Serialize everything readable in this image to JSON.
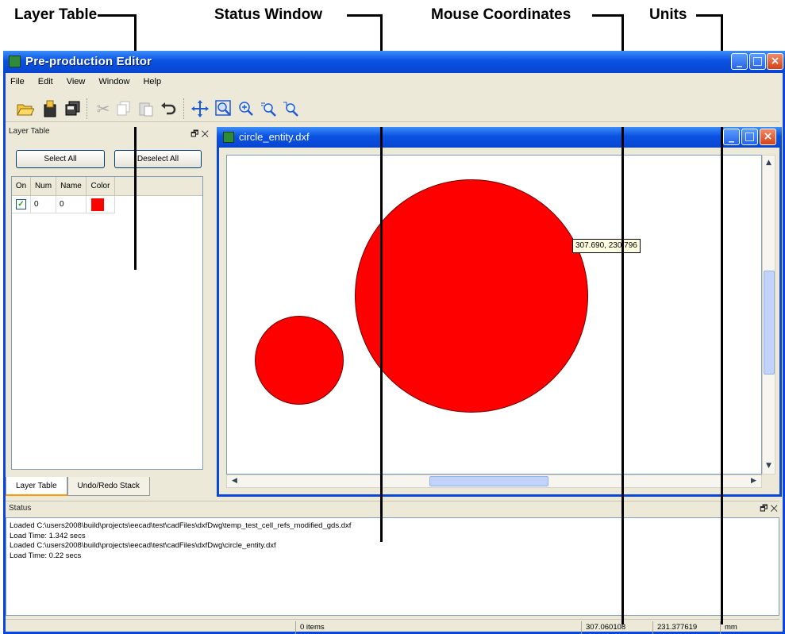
{
  "callouts": {
    "layer_table": "Layer Table",
    "status_window": "Status Window",
    "mouse_coordinates": "Mouse Coordinates",
    "units": "Units"
  },
  "app": {
    "title": "Pre-production Editor",
    "menu": [
      "File",
      "Edit",
      "View",
      "Window",
      "Help"
    ],
    "toolbar_icons": [
      "open-icon",
      "save-icon",
      "save-all-icon",
      "cut-icon",
      "copy-icon",
      "paste-icon",
      "undo-icon",
      "pan-icon",
      "zoom-window-icon",
      "zoom-in-icon",
      "zoom-out-icon",
      "zoom-fit-icon"
    ]
  },
  "layer_dock": {
    "title": "Layer Table",
    "select_all": "Select All",
    "deselect_all": "Deselect All",
    "columns": [
      "On",
      "Num",
      "Name",
      "Color"
    ],
    "rows": [
      {
        "on": true,
        "num": "0",
        "name": "0",
        "color": "#ff0000"
      }
    ],
    "tabs": [
      "Layer Table",
      "Undo/Redo Stack"
    ]
  },
  "document": {
    "title": "circle_entity.dxf",
    "tooltip": "307.690, 230.796",
    "shape_color": "#ff0000"
  },
  "status_dock": {
    "title": "Status",
    "log": [
      "Loaded C:\\users2008\\build\\projects\\eecad\\test\\cadFiles\\dxfDwg\\temp_test_cell_refs_modified_gds.dxf",
      "Load Time: 1.342 secs",
      "Loaded C:\\users2008\\build\\projects\\eecad\\test\\cadFiles\\dxfDwg\\circle_entity.dxf",
      "Load Time: 0.22 secs"
    ]
  },
  "statusbar": {
    "items": "0 items",
    "x": "307.060108",
    "y": "231.377619",
    "units": "mm"
  }
}
